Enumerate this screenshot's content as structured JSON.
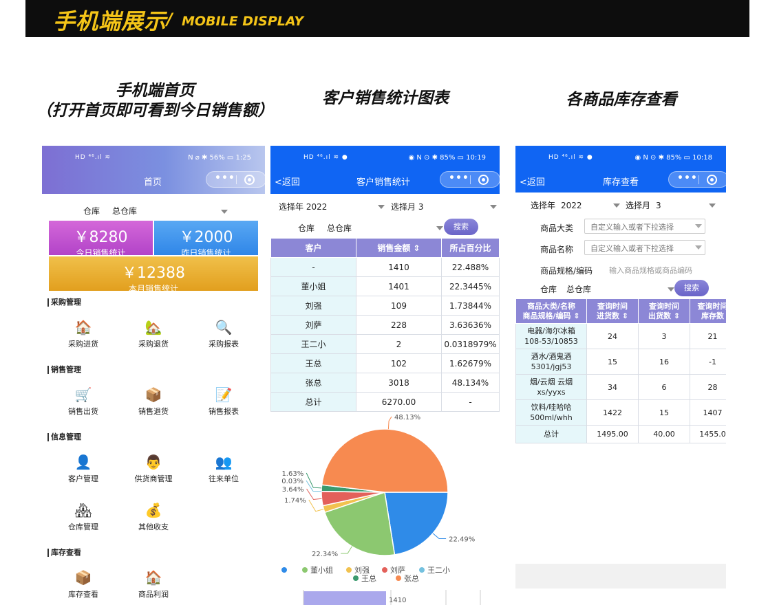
{
  "banner": {
    "title_cn": "手机端展示",
    "slash": "/",
    "title_en": "MOBILE DISPLAY"
  },
  "captions": {
    "home_line1": "手机端首页",
    "home_line2": "（打开首页即可看到今日销售额）",
    "customer": "客户销售统计图表",
    "inventory": "各商品库存查看"
  },
  "home": {
    "status_left": "HD ⁴⁶.ıl ≋",
    "status_right": "N ⌀ ✱ 56% ▭ 1:25",
    "title": "首页",
    "warehouse_label": "仓库",
    "warehouse_value": "总仓库",
    "cards": {
      "today_amount": "￥8280",
      "today_label": "今日销售统计",
      "yesterday_amount": "￥2000",
      "yesterday_label": "昨日销售统计",
      "month_amount": "￥12388",
      "month_label": "本月销售统计"
    },
    "sections": {
      "purchase": {
        "title": "采购管理",
        "items": [
          "采购进货",
          "采购退货",
          "采购报表"
        ]
      },
      "sales": {
        "title": "销售管理",
        "items": [
          "销售出货",
          "销售退货",
          "销售报表"
        ]
      },
      "info": {
        "title": "信息管理",
        "items": [
          "客户管理",
          "供货商管理",
          "往来单位",
          "仓库管理",
          "其他收支"
        ]
      },
      "stock": {
        "title": "库存查看",
        "items": [
          "库存查看",
          "商品利润"
        ]
      }
    }
  },
  "customer": {
    "status_left": "HD ⁴⁶.ıl ≋ ●",
    "status_right": "◉ N ⊙ ✱ 85% ▭ 10:19",
    "back": "<返回",
    "title": "客户销售统计",
    "year_label": "选择年 2022",
    "month_label": "选择月 3",
    "warehouse_label": "仓库",
    "warehouse_value": "总仓库",
    "search": "搜索",
    "headers": [
      "客户",
      "销售金额 ⇕",
      "所占百分比"
    ],
    "rows": [
      [
        "-",
        "1410",
        "22.488%"
      ],
      [
        "董小姐",
        "1401",
        "22.3445%"
      ],
      [
        "刘强",
        "109",
        "1.73844%"
      ],
      [
        "刘萨",
        "228",
        "3.63636%"
      ],
      [
        "王二小",
        "2",
        "0.0318979%"
      ],
      [
        "王总",
        "102",
        "1.62679%"
      ],
      [
        "张总",
        "3018",
        "48.134%"
      ],
      [
        "总计",
        "6270.00",
        "-"
      ]
    ],
    "bar_value": "1410"
  },
  "chart_data": {
    "type": "pie",
    "labels": [
      "",
      "董小姐",
      "刘强",
      "刘萨",
      "王二小",
      "王总",
      "张总"
    ],
    "values": [
      1410,
      1401,
      109,
      228,
      2,
      102,
      3018
    ],
    "slice_labels": [
      "22.49%",
      "22.34%",
      "1.74%",
      "3.64%",
      "0.03%",
      "1.63%",
      "48.13%"
    ],
    "colors": [
      "#2f8be8",
      "#8cc870",
      "#f1c24f",
      "#e3605a",
      "#74c1df",
      "#3b9a6e",
      "#f78a50"
    ],
    "legend": [
      "",
      "董小姐",
      "刘强",
      "刘萨",
      "王二小",
      "王总",
      "张总"
    ],
    "legend_placement": "bottom"
  },
  "inventory": {
    "status_left": "HD ⁴⁶.ıl ≋ ●",
    "status_right": "◉ N ⊙ ✱ 85% ▭ 10:18",
    "back": "<返回",
    "title": "库存查看",
    "year_label": "选择年",
    "year_value": "2022",
    "month_label": "选择月",
    "month_value": "3",
    "category_label": "商品大类",
    "category_placeholder": "自定义输入或者下拉选择",
    "name_label": "商品名称",
    "name_placeholder": "自定义输入或者下拉选择",
    "spec_label": "商品规格/编码",
    "spec_placeholder": "输入商品规格或商品编码",
    "warehouse_label": "仓库",
    "warehouse_value": "总仓库",
    "search": "搜索",
    "headers": [
      [
        "商品大类/名称",
        "商品规格/编码 ⇕"
      ],
      [
        "查询时间",
        "进货数 ⇕"
      ],
      [
        "查询时间",
        "出货数 ⇕"
      ],
      [
        "查询时间",
        "库存数"
      ]
    ],
    "rows": [
      [
        [
          "电器/海尔冰箱",
          "108-53/10853"
        ],
        "24",
        "3",
        "21"
      ],
      [
        [
          "酒水/酒鬼酒",
          "5301/jgj53"
        ],
        "15",
        "16",
        "-1"
      ],
      [
        [
          "烟/云烟 云烟",
          "xs/yyxs"
        ],
        "34",
        "6",
        "28"
      ],
      [
        [
          "饮料/哇哈哈",
          "500ml/whh"
        ],
        "1422",
        "15",
        "1407"
      ],
      [
        [
          "总计",
          ""
        ],
        "1495.00",
        "40.00",
        "1455.0"
      ]
    ]
  }
}
